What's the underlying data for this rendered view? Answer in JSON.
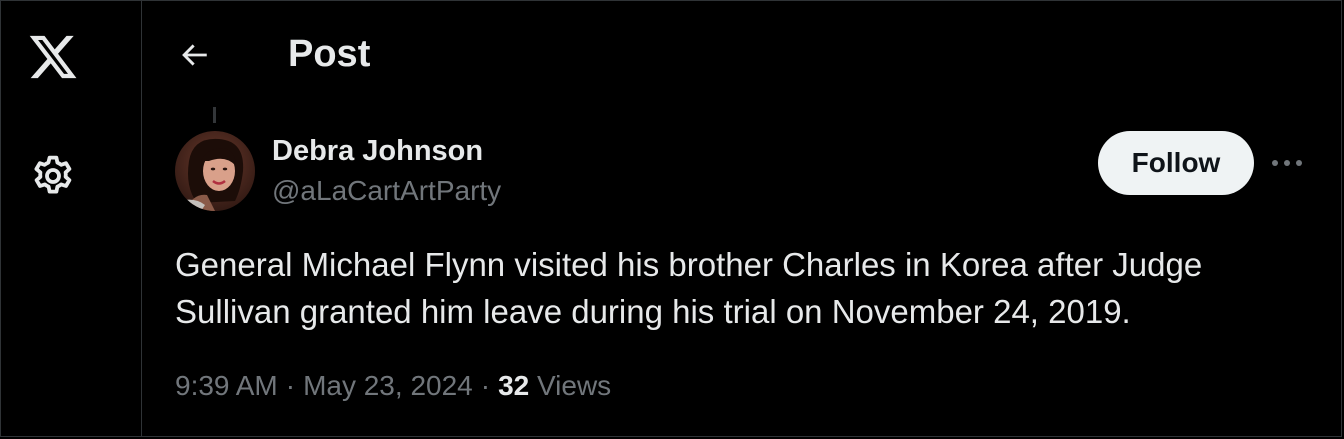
{
  "header": {
    "title": "Post"
  },
  "nav": {
    "logo_icon": "x-logo-icon",
    "settings_icon": "gear-icon",
    "back_icon": "arrow-left-icon"
  },
  "post": {
    "author": {
      "display_name": "Debra Johnson",
      "handle": "@aLaCartArtParty"
    },
    "follow_label": "Follow",
    "more_icon": "more-horizontal-icon",
    "text": "General Michael Flynn visited his brother Charles in Korea after Judge Sullivan granted him leave during his trial on November 24, 2019.",
    "time": "9:39 AM",
    "separator": "·",
    "date": "May 23, 2024",
    "views_count": "32",
    "views_label": "Views"
  },
  "colors": {
    "background": "#000000",
    "text_primary": "#e7e9ea",
    "text_secondary": "#71767b",
    "border": "#2f3336",
    "follow_bg": "#eff3f4"
  }
}
